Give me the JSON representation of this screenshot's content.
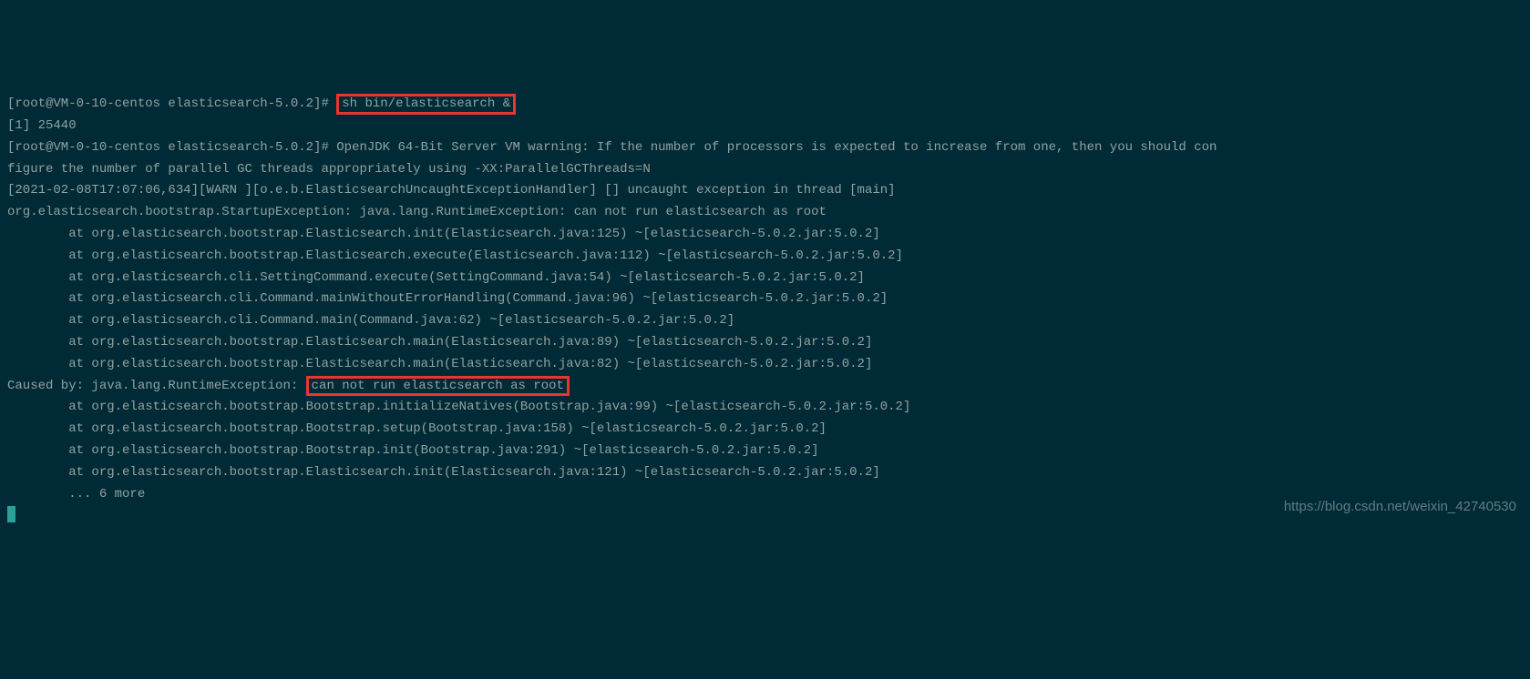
{
  "terminal": {
    "prompt1": "[root@VM-0-10-centos elasticsearch-5.0.2]# ",
    "cmd1": "sh bin/elasticsearch &",
    "jobLine": "[1] 25440",
    "prompt2": "[root@VM-0-10-centos elasticsearch-5.0.2]# ",
    "jvmWarning1": "OpenJDK 64-Bit Server VM warning: If the number of processors is expected to increase from one, then you should con",
    "jvmWarning2": "figure the number of parallel GC threads appropriately using -XX:ParallelGCThreads=N",
    "logWarn": "[2021-02-08T17:07:06,634][WARN ][o.e.b.ElasticsearchUncaughtExceptionHandler] [] uncaught exception in thread [main]",
    "exception": "org.elasticsearch.bootstrap.StartupException: java.lang.RuntimeException: can not run elasticsearch as root",
    "stack": [
      "        at org.elasticsearch.bootstrap.Elasticsearch.init(Elasticsearch.java:125) ~[elasticsearch-5.0.2.jar:5.0.2]",
      "        at org.elasticsearch.bootstrap.Elasticsearch.execute(Elasticsearch.java:112) ~[elasticsearch-5.0.2.jar:5.0.2]",
      "        at org.elasticsearch.cli.SettingCommand.execute(SettingCommand.java:54) ~[elasticsearch-5.0.2.jar:5.0.2]",
      "        at org.elasticsearch.cli.Command.mainWithoutErrorHandling(Command.java:96) ~[elasticsearch-5.0.2.jar:5.0.2]",
      "        at org.elasticsearch.cli.Command.main(Command.java:62) ~[elasticsearch-5.0.2.jar:5.0.2]",
      "        at org.elasticsearch.bootstrap.Elasticsearch.main(Elasticsearch.java:89) ~[elasticsearch-5.0.2.jar:5.0.2]",
      "        at org.elasticsearch.bootstrap.Elasticsearch.main(Elasticsearch.java:82) ~[elasticsearch-5.0.2.jar:5.0.2]"
    ],
    "causedByPrefix": "Caused by: java.lang.RuntimeException: ",
    "causedByMsg": "can not run elasticsearch as root",
    "stack2": [
      "        at org.elasticsearch.bootstrap.Bootstrap.initializeNatives(Bootstrap.java:99) ~[elasticsearch-5.0.2.jar:5.0.2]",
      "        at org.elasticsearch.bootstrap.Bootstrap.setup(Bootstrap.java:158) ~[elasticsearch-5.0.2.jar:5.0.2]",
      "        at org.elasticsearch.bootstrap.Bootstrap.init(Bootstrap.java:291) ~[elasticsearch-5.0.2.jar:5.0.2]",
      "        at org.elasticsearch.bootstrap.Elasticsearch.init(Elasticsearch.java:121) ~[elasticsearch-5.0.2.jar:5.0.2]",
      "        ... 6 more"
    ]
  },
  "watermark": "https://blog.csdn.net/weixin_42740530"
}
